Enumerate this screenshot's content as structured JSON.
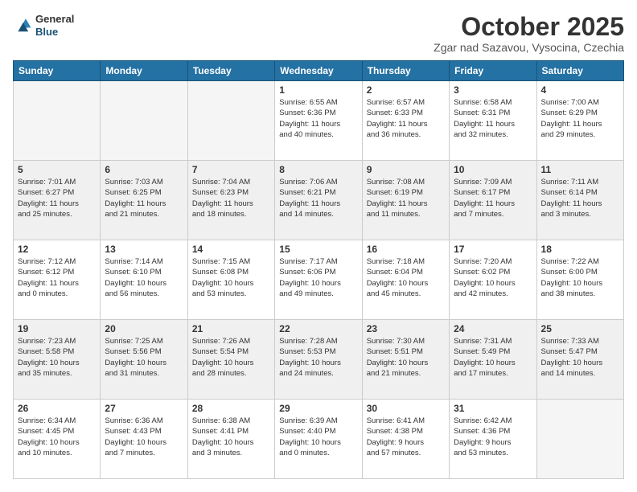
{
  "header": {
    "logo_line1": "General",
    "logo_line2": "Blue",
    "month": "October 2025",
    "location": "Zgar nad Sazavou, Vysocina, Czechia"
  },
  "weekdays": [
    "Sunday",
    "Monday",
    "Tuesday",
    "Wednesday",
    "Thursday",
    "Friday",
    "Saturday"
  ],
  "rows": [
    [
      {
        "day": "",
        "info": ""
      },
      {
        "day": "",
        "info": ""
      },
      {
        "day": "",
        "info": ""
      },
      {
        "day": "1",
        "info": "Sunrise: 6:55 AM\nSunset: 6:36 PM\nDaylight: 11 hours\nand 40 minutes."
      },
      {
        "day": "2",
        "info": "Sunrise: 6:57 AM\nSunset: 6:33 PM\nDaylight: 11 hours\nand 36 minutes."
      },
      {
        "day": "3",
        "info": "Sunrise: 6:58 AM\nSunset: 6:31 PM\nDaylight: 11 hours\nand 32 minutes."
      },
      {
        "day": "4",
        "info": "Sunrise: 7:00 AM\nSunset: 6:29 PM\nDaylight: 11 hours\nand 29 minutes."
      }
    ],
    [
      {
        "day": "5",
        "info": "Sunrise: 7:01 AM\nSunset: 6:27 PM\nDaylight: 11 hours\nand 25 minutes."
      },
      {
        "day": "6",
        "info": "Sunrise: 7:03 AM\nSunset: 6:25 PM\nDaylight: 11 hours\nand 21 minutes."
      },
      {
        "day": "7",
        "info": "Sunrise: 7:04 AM\nSunset: 6:23 PM\nDaylight: 11 hours\nand 18 minutes."
      },
      {
        "day": "8",
        "info": "Sunrise: 7:06 AM\nSunset: 6:21 PM\nDaylight: 11 hours\nand 14 minutes."
      },
      {
        "day": "9",
        "info": "Sunrise: 7:08 AM\nSunset: 6:19 PM\nDaylight: 11 hours\nand 11 minutes."
      },
      {
        "day": "10",
        "info": "Sunrise: 7:09 AM\nSunset: 6:17 PM\nDaylight: 11 hours\nand 7 minutes."
      },
      {
        "day": "11",
        "info": "Sunrise: 7:11 AM\nSunset: 6:14 PM\nDaylight: 11 hours\nand 3 minutes."
      }
    ],
    [
      {
        "day": "12",
        "info": "Sunrise: 7:12 AM\nSunset: 6:12 PM\nDaylight: 11 hours\nand 0 minutes."
      },
      {
        "day": "13",
        "info": "Sunrise: 7:14 AM\nSunset: 6:10 PM\nDaylight: 10 hours\nand 56 minutes."
      },
      {
        "day": "14",
        "info": "Sunrise: 7:15 AM\nSunset: 6:08 PM\nDaylight: 10 hours\nand 53 minutes."
      },
      {
        "day": "15",
        "info": "Sunrise: 7:17 AM\nSunset: 6:06 PM\nDaylight: 10 hours\nand 49 minutes."
      },
      {
        "day": "16",
        "info": "Sunrise: 7:18 AM\nSunset: 6:04 PM\nDaylight: 10 hours\nand 45 minutes."
      },
      {
        "day": "17",
        "info": "Sunrise: 7:20 AM\nSunset: 6:02 PM\nDaylight: 10 hours\nand 42 minutes."
      },
      {
        "day": "18",
        "info": "Sunrise: 7:22 AM\nSunset: 6:00 PM\nDaylight: 10 hours\nand 38 minutes."
      }
    ],
    [
      {
        "day": "19",
        "info": "Sunrise: 7:23 AM\nSunset: 5:58 PM\nDaylight: 10 hours\nand 35 minutes."
      },
      {
        "day": "20",
        "info": "Sunrise: 7:25 AM\nSunset: 5:56 PM\nDaylight: 10 hours\nand 31 minutes."
      },
      {
        "day": "21",
        "info": "Sunrise: 7:26 AM\nSunset: 5:54 PM\nDaylight: 10 hours\nand 28 minutes."
      },
      {
        "day": "22",
        "info": "Sunrise: 7:28 AM\nSunset: 5:53 PM\nDaylight: 10 hours\nand 24 minutes."
      },
      {
        "day": "23",
        "info": "Sunrise: 7:30 AM\nSunset: 5:51 PM\nDaylight: 10 hours\nand 21 minutes."
      },
      {
        "day": "24",
        "info": "Sunrise: 7:31 AM\nSunset: 5:49 PM\nDaylight: 10 hours\nand 17 minutes."
      },
      {
        "day": "25",
        "info": "Sunrise: 7:33 AM\nSunset: 5:47 PM\nDaylight: 10 hours\nand 14 minutes."
      }
    ],
    [
      {
        "day": "26",
        "info": "Sunrise: 6:34 AM\nSunset: 4:45 PM\nDaylight: 10 hours\nand 10 minutes."
      },
      {
        "day": "27",
        "info": "Sunrise: 6:36 AM\nSunset: 4:43 PM\nDaylight: 10 hours\nand 7 minutes."
      },
      {
        "day": "28",
        "info": "Sunrise: 6:38 AM\nSunset: 4:41 PM\nDaylight: 10 hours\nand 3 minutes."
      },
      {
        "day": "29",
        "info": "Sunrise: 6:39 AM\nSunset: 4:40 PM\nDaylight: 10 hours\nand 0 minutes."
      },
      {
        "day": "30",
        "info": "Sunrise: 6:41 AM\nSunset: 4:38 PM\nDaylight: 9 hours\nand 57 minutes."
      },
      {
        "day": "31",
        "info": "Sunrise: 6:42 AM\nSunset: 4:36 PM\nDaylight: 9 hours\nand 53 minutes."
      },
      {
        "day": "",
        "info": ""
      }
    ]
  ]
}
